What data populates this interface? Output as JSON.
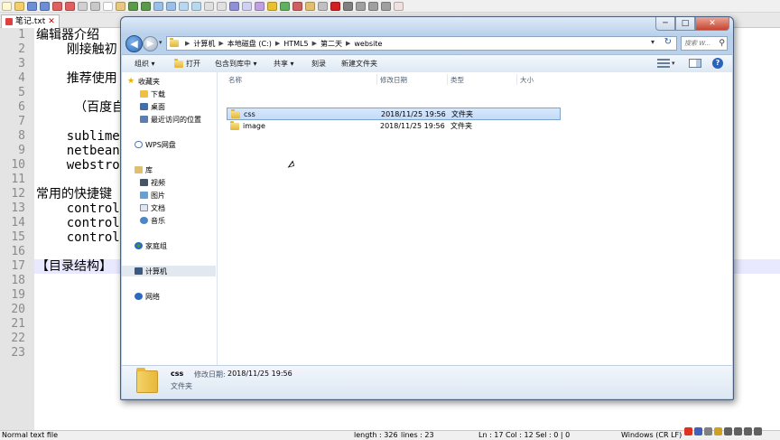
{
  "notepad": {
    "tab_title": "笔记.txt",
    "line_numbers": [
      "1",
      "2",
      "3",
      "4",
      "5",
      "6",
      "7",
      "8",
      "9",
      "10",
      "11",
      "12",
      "13",
      "14",
      "15",
      "16",
      "17",
      "18",
      "19",
      "20",
      "21",
      "22",
      "23"
    ],
    "visible_text": {
      "l1": "编辑器介绍",
      "l2": "    刚接触初",
      "l4": "    推荐使用",
      "l6": "     （百度自",
      "l8": "    sublime",
      "l9": "    netbean",
      "l10": "    webstro",
      "l12": "常用的快捷键",
      "l13": "    control",
      "l14": "    control",
      "l15": "    control",
      "l17": "【目录结构】"
    },
    "status": {
      "type": "Normal text file",
      "length": "length : 326",
      "lines": "lines : 23",
      "pos": "Ln : 17    Col : 12    Sel : 0 | 0",
      "eol": "Windows (CR LF)"
    }
  },
  "explorer": {
    "caption_buttons": {
      "minimize": "─",
      "maximize": "□",
      "close": "✕"
    },
    "address": {
      "crumbs": [
        "计算机",
        "本地磁盘 (C:)",
        "HTML5",
        "第二天",
        "website"
      ]
    },
    "search_placeholder": "搜索 W...",
    "commands": {
      "organize": "组织 ▾",
      "open": "打开",
      "include": "包含到库中 ▾",
      "share": "共享 ▾",
      "burn": "刻录",
      "new_folder": "新建文件夹"
    },
    "nav": {
      "favorites": "收藏夹",
      "downloads": "下载",
      "desktop": "桌面",
      "recent": "最近访问的位置",
      "wps": "WPS网盘",
      "libraries": "库",
      "videos": "视频",
      "pictures": "图片",
      "documents": "文档",
      "music": "音乐",
      "homegroup": "家庭组",
      "computer": "计算机",
      "network": "网络"
    },
    "columns": {
      "name": "名称",
      "modified": "修改日期",
      "type": "类型",
      "size": "大小"
    },
    "files": [
      {
        "name": "css",
        "modified": "2018/11/25 19:56",
        "type": "文件夹"
      },
      {
        "name": "image",
        "modified": "2018/11/25 19:56",
        "type": "文件夹"
      }
    ],
    "details": {
      "name": "css",
      "modified_label": "修改日期:",
      "modified": "2018/11/25 19:56",
      "type": "文件夹"
    }
  }
}
